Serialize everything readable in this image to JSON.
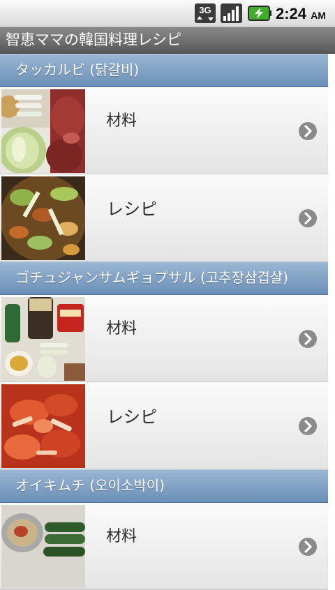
{
  "status_bar": {
    "network": "3G",
    "time": "2:24",
    "ampm": "AM"
  },
  "app": {
    "title": "智恵ママの韓国料理レシピ"
  },
  "sections": [
    {
      "title": "タッカルビ (닭갈비)",
      "rows": [
        {
          "label": "材料"
        },
        {
          "label": "レシピ"
        }
      ]
    },
    {
      "title": "ゴチュジャンサムギョプサル (고추장삼겹살)",
      "rows": [
        {
          "label": "材料"
        },
        {
          "label": "レシピ"
        }
      ]
    },
    {
      "title": "オイキムチ (오이소박이)",
      "rows": [
        {
          "label": "材料"
        }
      ]
    }
  ],
  "icons": {
    "row_chevron": "chevron-right-circle-icon",
    "network": "3g-data-icon",
    "signal": "signal-strength-icon",
    "battery": "battery-charging-icon"
  },
  "colors": {
    "section_header": "#7f9fc4",
    "title_bar": "#6e6e6e",
    "chevron": "#8a8a8a",
    "battery": "#3fae2a"
  }
}
